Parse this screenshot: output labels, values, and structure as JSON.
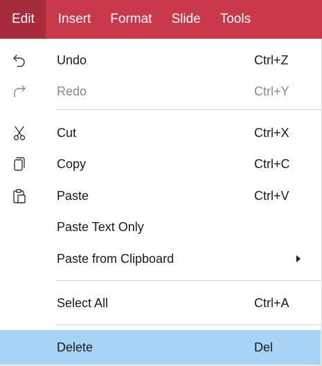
{
  "menubar": {
    "items": [
      {
        "label": "Edit"
      },
      {
        "label": "Insert"
      },
      {
        "label": "Format"
      },
      {
        "label": "Slide"
      },
      {
        "label": "Tools"
      }
    ]
  },
  "edit_menu": {
    "items": [
      {
        "label": "Undo",
        "shortcut": "Ctrl+Z",
        "icon": "undo-icon"
      },
      {
        "label": "Redo",
        "shortcut": "Ctrl+Y",
        "icon": "redo-icon",
        "disabled": true
      },
      {
        "label": "Cut",
        "shortcut": "Ctrl+X",
        "icon": "cut-icon"
      },
      {
        "label": "Copy",
        "shortcut": "Ctrl+C",
        "icon": "copy-icon"
      },
      {
        "label": "Paste",
        "shortcut": "Ctrl+V",
        "icon": "paste-icon"
      },
      {
        "label": "Paste Text Only",
        "shortcut": ""
      },
      {
        "label": "Paste from Clipboard",
        "shortcut": "",
        "has_submenu": true
      },
      {
        "label": "Select All",
        "shortcut": "Ctrl+A"
      },
      {
        "label": "Delete",
        "shortcut": "Del",
        "selected": true
      }
    ]
  },
  "colors": {
    "menubar_background": "#c9384b",
    "menubar_active": "#a82b3c",
    "selected_item": "#a9d3f5",
    "text": "#1a1a1a",
    "disabled_text": "#8a8a8a"
  }
}
